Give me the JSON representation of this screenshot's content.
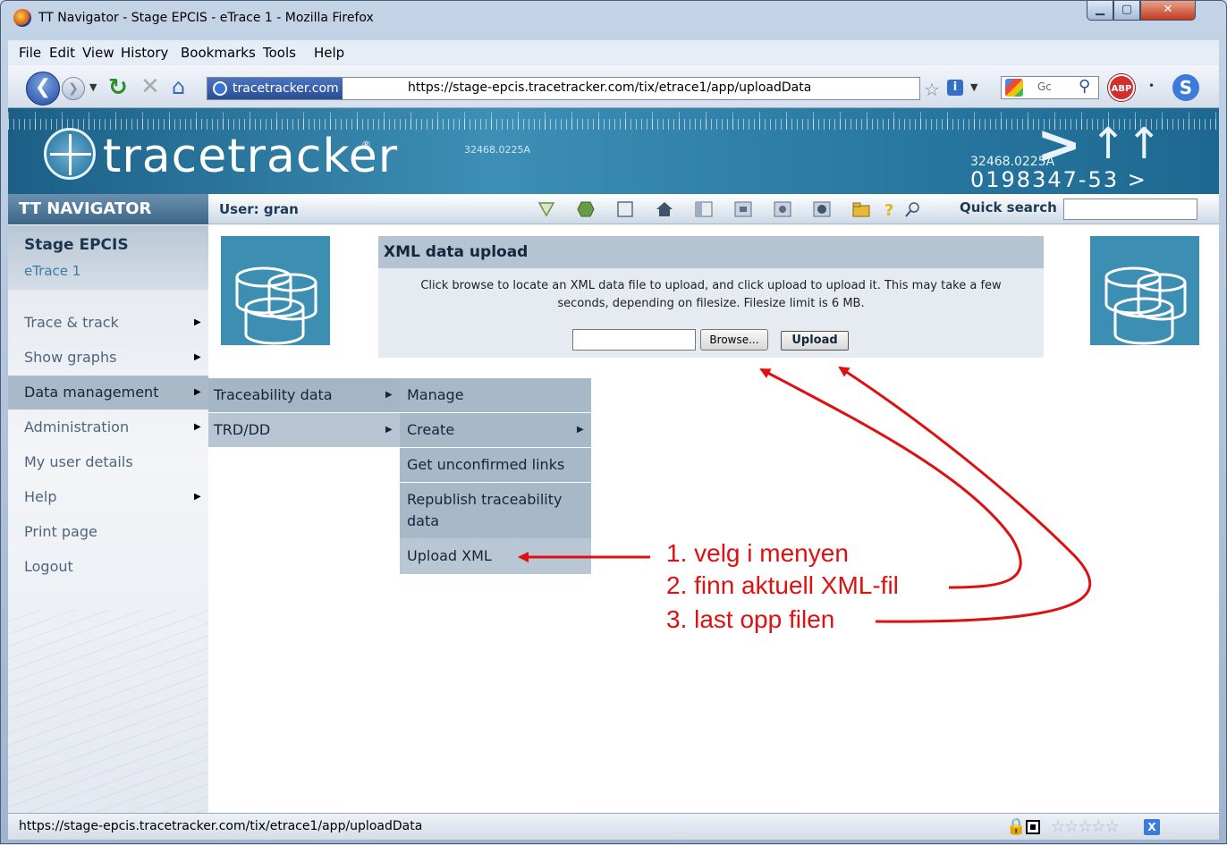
{
  "window": {
    "title": "TT Navigator - Stage EPCIS - eTrace 1 - Mozilla Firefox"
  },
  "menubar": [
    "File",
    "Edit",
    "View",
    "History",
    "Bookmarks",
    "Tools",
    "Help"
  ],
  "navbar": {
    "site_badge": "tracetracker.com",
    "url": "https://stage-epcis.tracetracker.com/tix/etrace1/app/uploadData",
    "search_text": "Gc",
    "abp_label": "ABP"
  },
  "banner": {
    "logo_text": "tracetracker",
    "code_small": "32468.0225A",
    "code_mid": "32468.0225A",
    "code_big": "0198347-53 >"
  },
  "toolbar": {
    "nav_title": "TT NAVIGATOR",
    "user_label": "User: gran",
    "quick_search_label": "Quick search",
    "icons": [
      "triangle-icon",
      "hexagon-icon",
      "square-icon",
      "home-icon",
      "columns-icon",
      "frame-icon",
      "camera-icon",
      "image-icon",
      "folder-icon",
      "help-icon",
      "search-icon"
    ]
  },
  "sidebar": {
    "title": "Stage EPCIS",
    "subtitle": "eTrace 1",
    "items": [
      {
        "label": "Trace & track",
        "arrow": true
      },
      {
        "label": "Show graphs",
        "arrow": true
      },
      {
        "label": "Data management",
        "arrow": true
      },
      {
        "label": "Administration",
        "arrow": true
      },
      {
        "label": "My user details",
        "arrow": false
      },
      {
        "label": "Help",
        "arrow": true
      },
      {
        "label": "Print page",
        "arrow": false
      },
      {
        "label": "Logout",
        "arrow": false
      }
    ]
  },
  "submenu1": [
    {
      "label": "Traceability data",
      "arrow": true
    },
    {
      "label": "TRD/DD",
      "arrow": true
    }
  ],
  "submenu2": [
    {
      "label": "Manage",
      "arrow": false
    },
    {
      "label": "Create",
      "arrow": true
    },
    {
      "label": "Get unconfirmed links",
      "arrow": false
    },
    {
      "label": "Republish traceability data",
      "arrow": false
    },
    {
      "label": "Upload XML",
      "arrow": false
    }
  ],
  "upload": {
    "title": "XML data upload",
    "description": "Click browse to locate an XML data file to upload, and click upload to upload it. This may take a few seconds, depending on filesize. Filesize limit is 6 MB.",
    "browse_label": "Browse...",
    "upload_label": "Upload"
  },
  "annotations": {
    "step1": "1. velg i menyen",
    "step2": "2. finn aktuell XML-fil",
    "step3": "3. last opp filen",
    "color": "#e01010"
  },
  "statusbar": {
    "url": "https://stage-epcis.tracetracker.com/tix/etrace1/app/uploadData"
  },
  "colors": {
    "accent": "#3c8fb3",
    "menu_active": "#a9b9c8",
    "banner": "#2a7aa4"
  }
}
